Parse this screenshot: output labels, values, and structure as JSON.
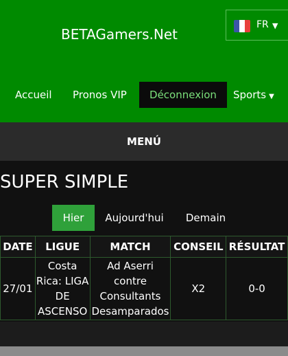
{
  "header": {
    "brand": "BETAGamers.Net",
    "language": {
      "label": "FR",
      "flag_colors": [
        "#3b55a8",
        "#ffffff",
        "#e8403c"
      ]
    }
  },
  "nav": {
    "items": [
      {
        "label": "Accueil"
      },
      {
        "label": "Pronos VIP"
      },
      {
        "label": "Déconnexion"
      },
      {
        "label": "Sports"
      }
    ]
  },
  "menu": {
    "label": "MENÚ"
  },
  "page": {
    "title": "SUPER SIMPLE"
  },
  "tabs": [
    {
      "label": "Hier",
      "active": true
    },
    {
      "label": "Aujourd'hui",
      "active": false
    },
    {
      "label": "Demain",
      "active": false
    }
  ],
  "table": {
    "columns": [
      "DATE",
      "LIGUE",
      "MATCH",
      "CONSEIL",
      "RÉSULTAT"
    ],
    "rows": [
      {
        "date": "27/01",
        "league": "Costa Rica: LIGA DE ASCENSO",
        "match": "Ad Aserri contre Consultants Desamparados",
        "tip": "X2",
        "result": "0-0"
      }
    ]
  },
  "colors": {
    "header_green": "#008a00",
    "active_tab_green": "#2fa13a",
    "active_nav_text": "#7be07b",
    "background": "#111111"
  }
}
